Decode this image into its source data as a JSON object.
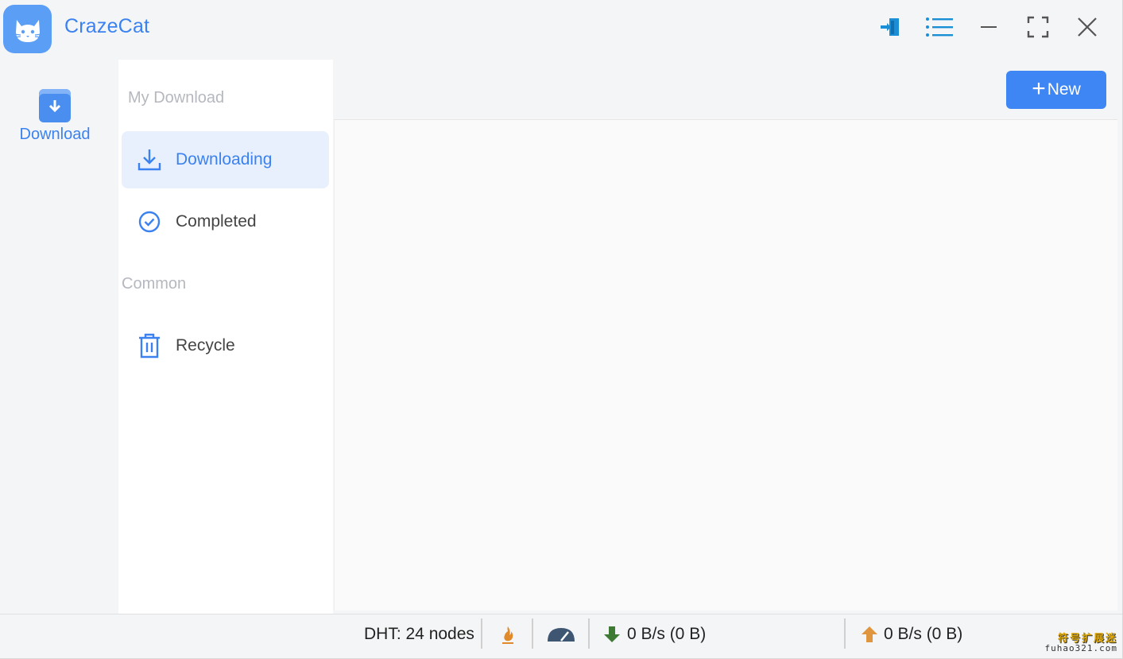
{
  "app": {
    "title": "CrazeCat",
    "brand_color": "#3b82f0",
    "logo_icon": "cat-face-icon"
  },
  "titlebar": {
    "buttons": [
      {
        "name": "login-icon"
      },
      {
        "name": "menu-icon"
      },
      {
        "name": "minimize-icon"
      },
      {
        "name": "maximize-icon"
      },
      {
        "name": "close-icon"
      }
    ]
  },
  "rail": {
    "items": [
      {
        "label": "Download",
        "icon": "download-box-icon",
        "active": true
      }
    ]
  },
  "nav": {
    "sections": [
      {
        "title": "My Download",
        "items": [
          {
            "label": "Downloading",
            "icon": "download-tray-icon",
            "active": true
          },
          {
            "label": "Completed",
            "icon": "check-circle-icon",
            "active": false
          }
        ]
      },
      {
        "title": "Common",
        "items": [
          {
            "label": "Recycle",
            "icon": "trash-icon",
            "active": false
          }
        ]
      }
    ]
  },
  "toolbar": {
    "new_button_label": "New",
    "new_button_icon": "plus-icon"
  },
  "statusbar": {
    "dht": "DHT: 24 nodes",
    "download_speed": "0 B/s (0 B)",
    "upload_speed": "0 B/s (0 B)",
    "download_arrow_color": "#3f7a35",
    "upload_arrow_color": "#e0953f"
  },
  "watermark": {
    "line1": "符号扩展迷",
    "line2": "fuhao321.com"
  }
}
